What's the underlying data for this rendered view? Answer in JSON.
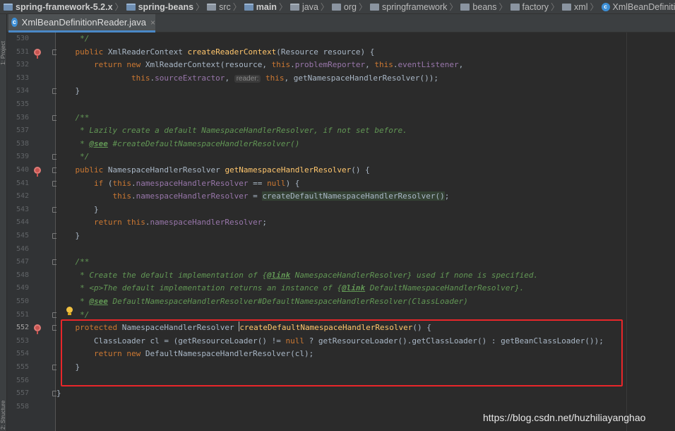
{
  "breadcrumb": [
    {
      "icon": "module-icon",
      "text": "spring-framework-5.2.x",
      "bold": true
    },
    {
      "icon": "module-icon",
      "text": "spring-beans",
      "bold": true
    },
    {
      "icon": "folder-icon",
      "text": "src",
      "bold": false
    },
    {
      "icon": "source-root-icon",
      "text": "main",
      "bold": true
    },
    {
      "icon": "folder-icon",
      "text": "java",
      "bold": false
    },
    {
      "icon": "package-icon",
      "text": "org",
      "bold": false
    },
    {
      "icon": "package-icon",
      "text": "springframework",
      "bold": false
    },
    {
      "icon": "package-icon",
      "text": "beans",
      "bold": false
    },
    {
      "icon": "package-icon",
      "text": "factory",
      "bold": false
    },
    {
      "icon": "package-icon",
      "text": "xml",
      "bold": false
    },
    {
      "icon": "class-icon",
      "text": "XmlBeanDefinitionReader",
      "bold": false
    }
  ],
  "tab": {
    "title": "XmlBeanDefinitionReader.java",
    "icon": "class-icon",
    "close": "×"
  },
  "left_tool_labels": [
    "1: Project",
    "2: Structure"
  ],
  "colors": {
    "keyword": "#cc7832",
    "field": "#9876aa",
    "method": "#ffc66d",
    "comment": "#629755",
    "text": "#a9b7c6",
    "annotation_box": "#e8262a"
  },
  "editor": {
    "current_line": "552",
    "lines": [
      {
        "n": "530",
        "tokens": [
          {
            "t": "\t */",
            "c": "cmt"
          }
        ]
      },
      {
        "n": "531",
        "ovr": true,
        "fold": true,
        "tokens": [
          {
            "t": "\tpublic ",
            "c": "kw"
          },
          {
            "t": "XmlReaderContext "
          },
          {
            "t": "createReaderContext",
            "c": "mth"
          },
          {
            "t": "(Resource resource) {"
          }
        ]
      },
      {
        "n": "532",
        "tokens": [
          {
            "t": "\t\treturn new ",
            "c": "kw"
          },
          {
            "t": "XmlReaderContext(resource, "
          },
          {
            "t": "this",
            "c": "kw"
          },
          {
            "t": "."
          },
          {
            "t": "problemReporter",
            "c": "fld"
          },
          {
            "t": ", "
          },
          {
            "t": "this",
            "c": "kw"
          },
          {
            "t": "."
          },
          {
            "t": "eventListener",
            "c": "fld"
          },
          {
            "t": ","
          }
        ]
      },
      {
        "n": "533",
        "tokens": [
          {
            "t": "\t\t\t\tthis",
            "c": "kw"
          },
          {
            "t": "."
          },
          {
            "t": "sourceExtractor",
            "c": "fld"
          },
          {
            "t": ", "
          },
          {
            "t": "reader:",
            "c": "hint"
          },
          {
            "t": " "
          },
          {
            "t": "this",
            "c": "kw"
          },
          {
            "t": ", getNamespaceHandlerResolver());"
          }
        ]
      },
      {
        "n": "534",
        "fold": true,
        "tokens": [
          {
            "t": "\t}"
          }
        ]
      },
      {
        "n": "535",
        "tokens": []
      },
      {
        "n": "536",
        "fold": true,
        "tokens": [
          {
            "t": "\t/**",
            "c": "cmt"
          }
        ]
      },
      {
        "n": "537",
        "tokens": [
          {
            "t": "\t * Lazily create a default NamespaceHandlerResolver, if not set before.",
            "c": "cmt"
          }
        ]
      },
      {
        "n": "538",
        "tokens": [
          {
            "t": "\t * ",
            "c": "cmt"
          },
          {
            "t": "@see",
            "c": "tag"
          },
          {
            "t": " #createDefaultNamespaceHandlerResolver()",
            "c": "cmt"
          }
        ]
      },
      {
        "n": "539",
        "fold": true,
        "tokens": [
          {
            "t": "\t */",
            "c": "cmt"
          }
        ]
      },
      {
        "n": "540",
        "ovr": true,
        "fold": true,
        "tokens": [
          {
            "t": "\tpublic ",
            "c": "kw"
          },
          {
            "t": "NamespaceHandlerResolver "
          },
          {
            "t": "getNamespaceHandlerResolver",
            "c": "mth"
          },
          {
            "t": "() {"
          }
        ]
      },
      {
        "n": "541",
        "fold": true,
        "tokens": [
          {
            "t": "\t\tif ",
            "c": "kw"
          },
          {
            "t": "("
          },
          {
            "t": "this",
            "c": "kw"
          },
          {
            "t": "."
          },
          {
            "t": "namespaceHandlerResolver",
            "c": "fld"
          },
          {
            "t": " == "
          },
          {
            "t": "null",
            "c": "kw"
          },
          {
            "t": ") {"
          }
        ]
      },
      {
        "n": "542",
        "tokens": [
          {
            "t": "\t\t\tthis",
            "c": "kw"
          },
          {
            "t": "."
          },
          {
            "t": "namespaceHandlerResolver",
            "c": "fld"
          },
          {
            "t": " = "
          },
          {
            "t": "createDefaultNamespaceHandlerResolver()",
            "c": "hl"
          },
          {
            "t": ";"
          }
        ]
      },
      {
        "n": "543",
        "fold": true,
        "tokens": [
          {
            "t": "\t\t}"
          }
        ]
      },
      {
        "n": "544",
        "tokens": [
          {
            "t": "\t\treturn this",
            "c": "kw"
          },
          {
            "t": "."
          },
          {
            "t": "namespaceHandlerResolver",
            "c": "fld"
          },
          {
            "t": ";"
          }
        ]
      },
      {
        "n": "545",
        "fold": true,
        "tokens": [
          {
            "t": "\t}"
          }
        ]
      },
      {
        "n": "546",
        "tokens": []
      },
      {
        "n": "547",
        "fold": true,
        "tokens": [
          {
            "t": "\t/**",
            "c": "cmt"
          }
        ]
      },
      {
        "n": "548",
        "tokens": [
          {
            "t": "\t * Create the default implementation of {",
            "c": "cmt"
          },
          {
            "t": "@link",
            "c": "tag"
          },
          {
            "t": " NamespaceHandlerResolver} used if none is specified.",
            "c": "cmt"
          }
        ]
      },
      {
        "n": "549",
        "tokens": [
          {
            "t": "\t * <p>The default implementation returns an instance of {",
            "c": "cmt"
          },
          {
            "t": "@link",
            "c": "tag"
          },
          {
            "t": " DefaultNamespaceHandlerResolver}.",
            "c": "cmt"
          }
        ]
      },
      {
        "n": "550",
        "tokens": [
          {
            "t": "\t * ",
            "c": "cmt"
          },
          {
            "t": "@see",
            "c": "tag"
          },
          {
            "t": " DefaultNamespaceHandlerResolver#DefaultNamespaceHandlerResolver(ClassLoader)",
            "c": "cmt"
          }
        ]
      },
      {
        "n": "551",
        "fold": true,
        "tokens": [
          {
            "t": "\t */",
            "c": "cmt"
          }
        ]
      },
      {
        "n": "552",
        "ovr": true,
        "fold": true,
        "tokens": [
          {
            "t": "\tprotected ",
            "c": "kw"
          },
          {
            "t": "NamespaceHandlerResolver "
          },
          {
            "t": "|",
            "c": "caret"
          },
          {
            "t": "createDefaultNamespaceHandlerResolver",
            "c": "mth"
          },
          {
            "t": "() {"
          }
        ]
      },
      {
        "n": "553",
        "tokens": [
          {
            "t": "\t\tClassLoader cl = (getResourceLoader() != "
          },
          {
            "t": "null",
            "c": "kw"
          },
          {
            "t": " ? getResourceLoader().getClassLoader() : getBeanClassLoader());"
          }
        ]
      },
      {
        "n": "554",
        "tokens": [
          {
            "t": "\t\treturn new ",
            "c": "kw"
          },
          {
            "t": "DefaultNamespaceHandlerResolver(cl);"
          }
        ]
      },
      {
        "n": "555",
        "fold": true,
        "tokens": [
          {
            "t": "\t}"
          }
        ]
      },
      {
        "n": "556",
        "tokens": []
      },
      {
        "n": "557",
        "fold": true,
        "tokens": [
          {
            "t": "}"
          }
        ]
      },
      {
        "n": "558",
        "tokens": []
      }
    ]
  },
  "watermark": "https://blog.csdn.net/huzhiliayanghao"
}
